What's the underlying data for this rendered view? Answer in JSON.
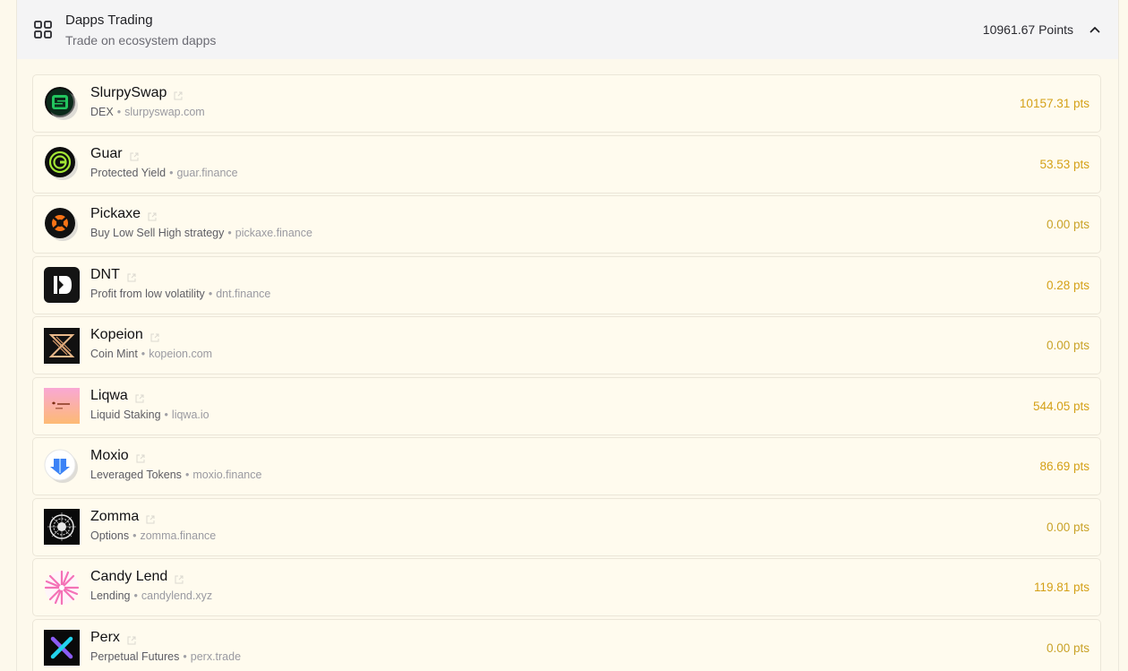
{
  "section": {
    "title": "Dapps Trading",
    "subtitle": "Trade on ecosystem dapps",
    "points": "10961.67 Points",
    "grid_icon": "grid-icon",
    "toggle_icon": "chevron-up-icon"
  },
  "items": [
    {
      "name": "SlurpySwap",
      "category": "DEX",
      "url": "slurpyswap.com",
      "points": "10157.31 pts",
      "logo": "slurpyswap-logo"
    },
    {
      "name": "Guar",
      "category": "Protected Yield",
      "url": "guar.finance",
      "points": "53.53 pts",
      "logo": "guar-logo"
    },
    {
      "name": "Pickaxe",
      "category": "Buy Low Sell High strategy",
      "url": "pickaxe.finance",
      "points": "0.00 pts",
      "logo": "pickaxe-logo"
    },
    {
      "name": "DNT",
      "category": "Profit from low volatility",
      "url": "dnt.finance",
      "points": "0.28 pts",
      "logo": "dnt-logo"
    },
    {
      "name": "Kopeion",
      "category": "Coin Mint",
      "url": "kopeion.com",
      "points": "0.00 pts",
      "logo": "kopeion-logo"
    },
    {
      "name": "Liqwa",
      "category": "Liquid Staking",
      "url": "liqwa.io",
      "points": "544.05 pts",
      "logo": "liqwa-logo"
    },
    {
      "name": "Moxio",
      "category": "Leveraged Tokens",
      "url": "moxio.finance",
      "points": "86.69 pts",
      "logo": "moxio-logo"
    },
    {
      "name": "Zomma",
      "category": "Options",
      "url": "zomma.finance",
      "points": "0.00 pts",
      "logo": "zomma-logo"
    },
    {
      "name": "Candy Lend",
      "category": "Lending",
      "url": "candylend.xyz",
      "points": "119.81 pts",
      "logo": "candylend-logo"
    },
    {
      "name": "Perx",
      "category": "Perpetual Futures",
      "url": "perx.trade",
      "points": "0.00 pts",
      "logo": "perx-logo"
    }
  ],
  "colors": {
    "accent_points": "#d4a017",
    "background": "#fdf9ec"
  }
}
